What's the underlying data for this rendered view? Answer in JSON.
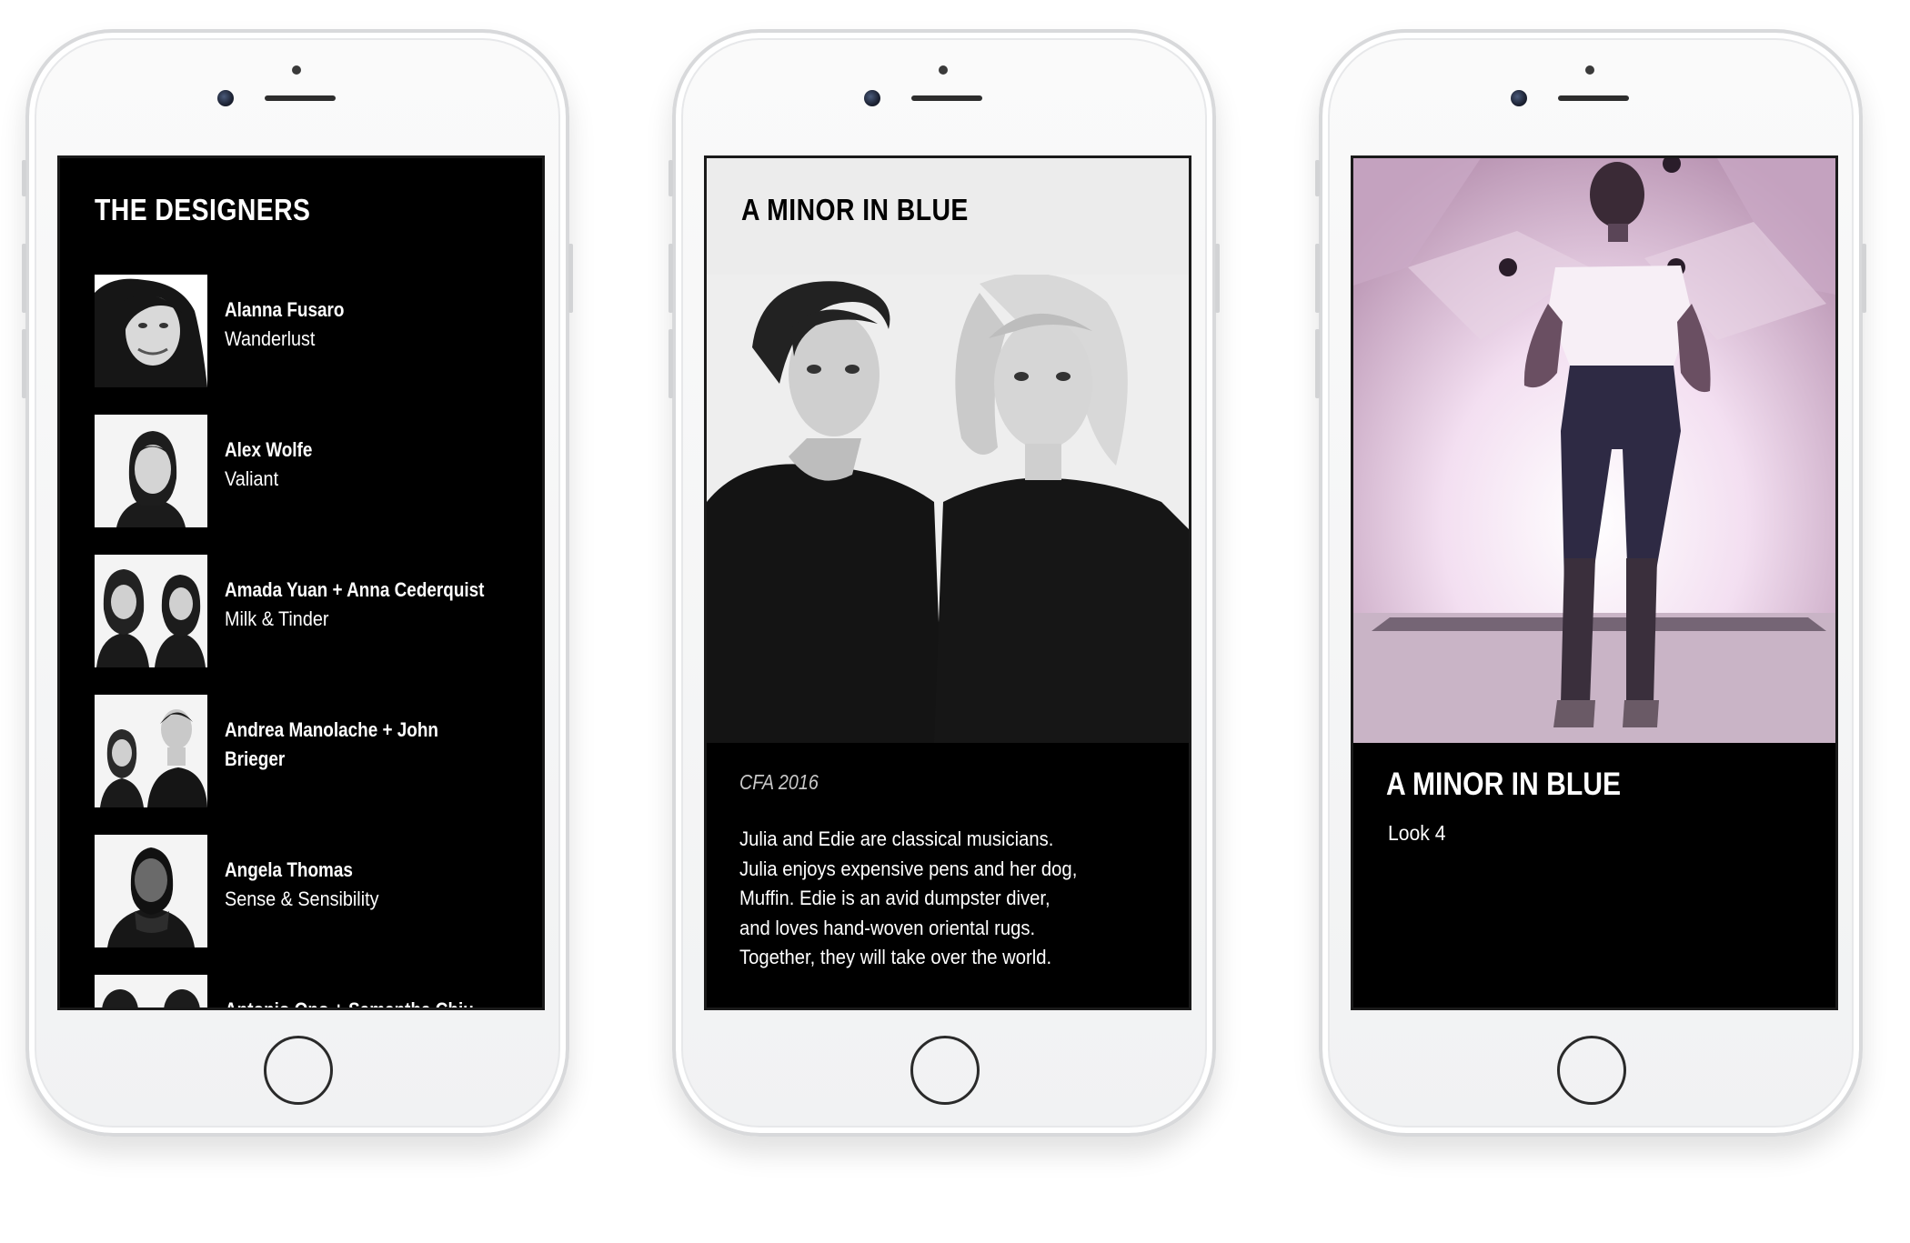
{
  "designers_screen": {
    "title": "THE DESIGNERS",
    "designers": [
      {
        "name": "Alanna Fusaro",
        "collection": "Wanderlust"
      },
      {
        "name": "Alex Wolfe",
        "collection": "Valiant"
      },
      {
        "name": "Amada Yuan + Anna Cederquist",
        "collection": "Milk & Tinder"
      },
      {
        "name_line1": "Andrea Manolache + John",
        "name_line2": "Brieger"
      },
      {
        "name": "Angela Thomas",
        "collection": "Sense & Sensibility"
      },
      {
        "name": "Antonio Ono + Samantha Chiu"
      }
    ]
  },
  "collection_screen": {
    "title": "A MINOR IN BLUE",
    "program": "CFA 2016",
    "bio_lines": [
      "Julia and Edie are classical musicians.",
      "Julia enjoys expensive pens and her dog,",
      "Muffin. Edie is an avid dumpster diver,",
      "and loves hand-woven oriental rugs.",
      "Together, they will take over the world."
    ]
  },
  "look_screen": {
    "title": "A MINOR IN BLUE",
    "subtitle": "Look 4"
  },
  "colors": {
    "screen_bg": "#000000",
    "phone_body": "#f2f2f3",
    "text": "#ffffff",
    "photo_tint": "#d9b8d6"
  },
  "icons": [
    "front-camera-icon",
    "earpiece-speaker-icon",
    "home-button-icon"
  ]
}
